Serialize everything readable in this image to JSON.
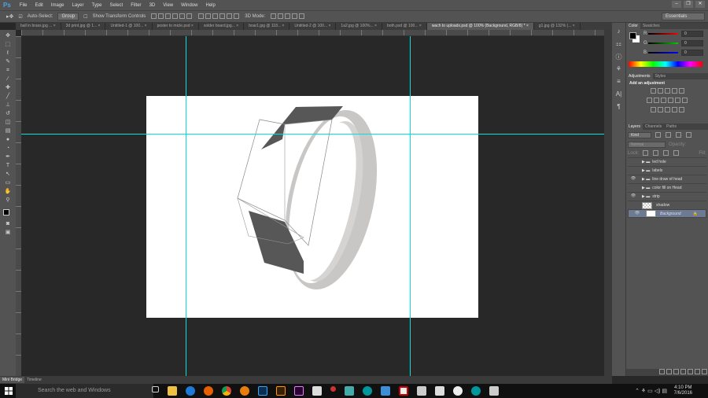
{
  "app": {
    "logo": "Ps"
  },
  "menu": [
    "File",
    "Edit",
    "Image",
    "Layer",
    "Type",
    "Select",
    "Filter",
    "3D",
    "View",
    "Window",
    "Help"
  ],
  "options": {
    "auto_select_label": "Auto-Select:",
    "auto_select_checked": true,
    "auto_select_value": "Group",
    "show_transform_label": "Show Transform Controls",
    "mode_3d_label": "3D Mode:",
    "workspace": "Essentials"
  },
  "tabs": [
    {
      "label": "ball in brass.jpg ...",
      "active": false
    },
    {
      "label": "3d print.jpg @ 1...",
      "active": false
    },
    {
      "label": "Untitled-1 @ 100...",
      "active": false
    },
    {
      "label": "poster to micle.psd",
      "active": false
    },
    {
      "label": "solder board.jpg...",
      "active": false
    },
    {
      "label": "boar1.jpg @ 118...",
      "active": false
    },
    {
      "label": "Untitled-2 @ 100...",
      "active": false
    },
    {
      "label": "1a2.jpg @ 100%...",
      "active": false
    },
    {
      "label": "both.psd @ 100...",
      "active": false
    },
    {
      "label": "wach to uploadx.psd @ 100% (Background, RGB/8) *",
      "active": true
    },
    {
      "label": "g1.jpg @ 132% (...",
      "active": false
    }
  ],
  "color_panel": {
    "tabs": [
      "Color",
      "Swatches"
    ],
    "r": "0",
    "g": "0",
    "b": "0",
    "r_label": "R",
    "g_label": "G",
    "b_label": "B",
    "foreground": "#000000",
    "background": "#ffffff"
  },
  "adjustments": {
    "tabs": [
      "Adjustments",
      "Styles"
    ],
    "title": "Add an adjustment"
  },
  "layers_panel": {
    "tabs": [
      "Layers",
      "Channels",
      "Paths"
    ],
    "filter": "Kind",
    "blend_mode": "Normal",
    "opacity_label": "Opacity:",
    "fill_label": "Fill:",
    "lock_label": "Lock:",
    "layers": [
      {
        "name": "led hole",
        "type": "group",
        "visible": false
      },
      {
        "name": "labels",
        "type": "group",
        "visible": false
      },
      {
        "name": "line draw of head",
        "type": "group",
        "visible": true
      },
      {
        "name": "color fill on Head",
        "type": "group",
        "visible": false
      },
      {
        "name": "strip",
        "type": "group",
        "visible": true
      },
      {
        "name": "shadow",
        "type": "layer",
        "visible": false
      },
      {
        "name": "Background",
        "type": "layer",
        "visible": true,
        "selected": true,
        "locked": true
      }
    ]
  },
  "bottom_tabs": [
    "Mini Bridge",
    "Timeline"
  ],
  "taskbar": {
    "search_placeholder": "Search the web and Windows",
    "time": "4:10 PM",
    "date": "7/6/2016"
  },
  "colors": {
    "guide": "#00e0e0",
    "accent": "#4fa3e0"
  }
}
